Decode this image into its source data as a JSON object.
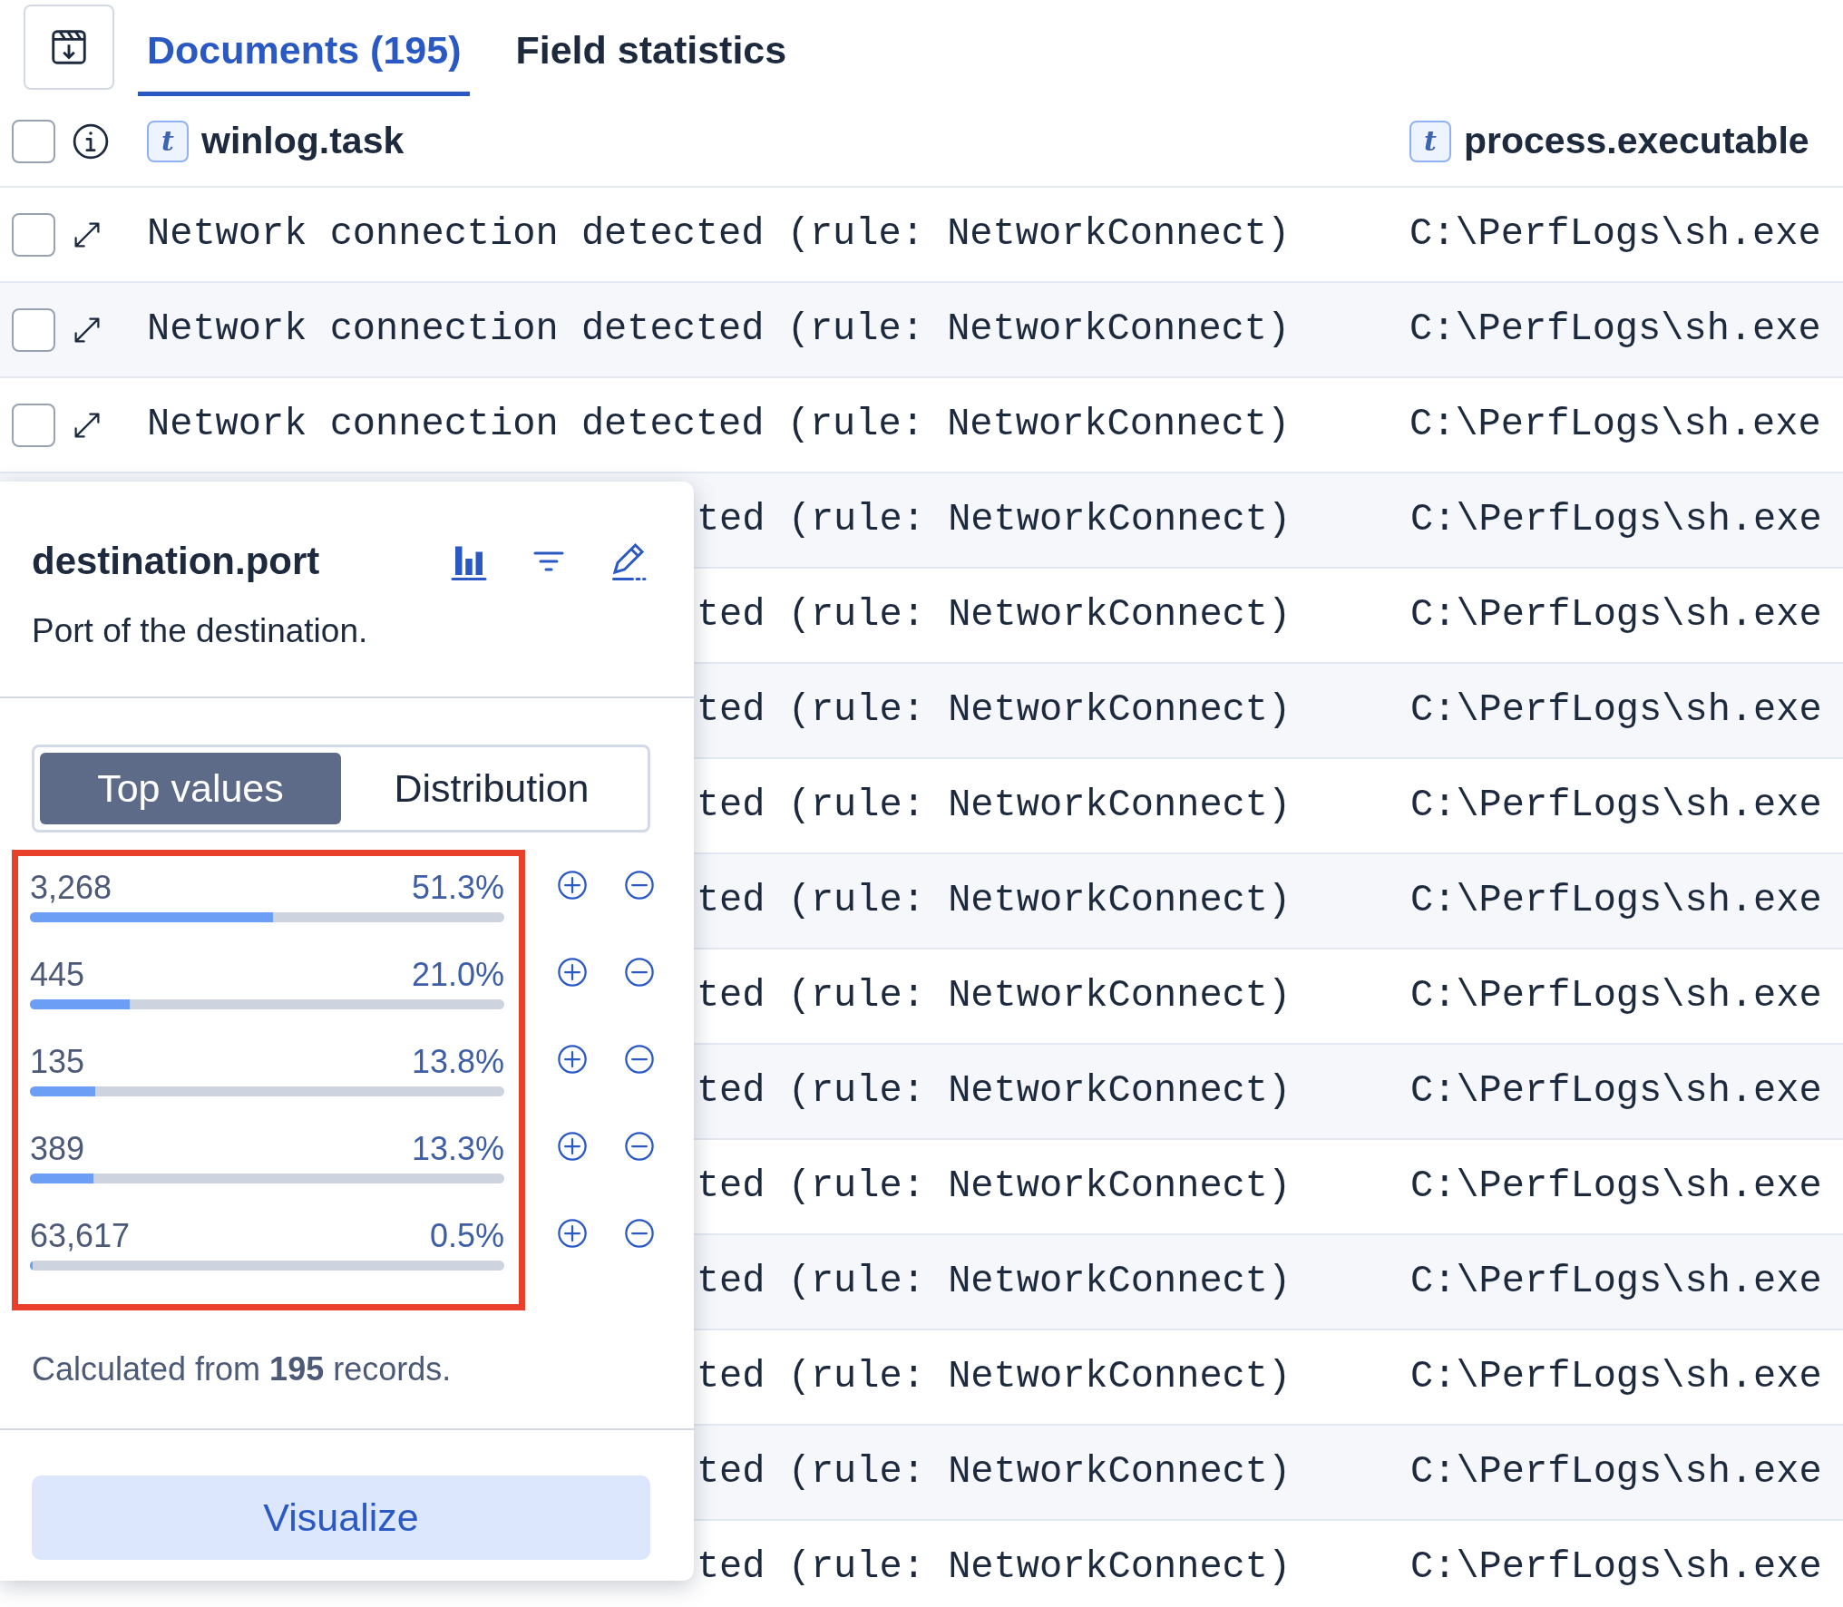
{
  "toolbar": {
    "tabs": [
      {
        "label": "Documents (195)",
        "selected": true
      },
      {
        "label": "Field statistics",
        "selected": false
      }
    ]
  },
  "table": {
    "header": {
      "checked": false,
      "columns": [
        {
          "type": "t",
          "name": "winlog.task"
        },
        {
          "type": "t",
          "name": "process.executable"
        }
      ]
    },
    "rows": [
      {
        "kind": "full",
        "checked": false,
        "task": "Network connection detected (rule: NetworkConnect)",
        "executable": "C:\\PerfLogs\\sh.exe"
      },
      {
        "kind": "full",
        "checked": false,
        "task": "Network connection detected (rule: NetworkConnect)",
        "executable": "C:\\PerfLogs\\sh.exe"
      },
      {
        "kind": "full",
        "checked": false,
        "task": "Network connection detected (rule: NetworkConnect)",
        "executable": "C:\\PerfLogs\\sh.exe"
      },
      {
        "kind": "partial",
        "task": "ted (rule: NetworkConnect)",
        "executable": "C:\\PerfLogs\\sh.exe"
      },
      {
        "kind": "partial",
        "task": "ted (rule: NetworkConnect)",
        "executable": "C:\\PerfLogs\\sh.exe"
      },
      {
        "kind": "partial",
        "task": "ted (rule: NetworkConnect)",
        "executable": "C:\\PerfLogs\\sh.exe"
      },
      {
        "kind": "partial",
        "task": "ted (rule: NetworkConnect)",
        "executable": "C:\\PerfLogs\\sh.exe"
      },
      {
        "kind": "partial",
        "task": "ted (rule: NetworkConnect)",
        "executable": "C:\\PerfLogs\\sh.exe"
      },
      {
        "kind": "partial",
        "task": "ted (rule: NetworkConnect)",
        "executable": "C:\\PerfLogs\\sh.exe"
      },
      {
        "kind": "partial",
        "task": "ted (rule: NetworkConnect)",
        "executable": "C:\\PerfLogs\\sh.exe"
      },
      {
        "kind": "partial",
        "task": "ted (rule: NetworkConnect)",
        "executable": "C:\\PerfLogs\\sh.exe"
      },
      {
        "kind": "partial",
        "task": "ted (rule: NetworkConnect)",
        "executable": "C:\\PerfLogs\\sh.exe"
      },
      {
        "kind": "partial",
        "task": "ted (rule: NetworkConnect)",
        "executable": "C:\\PerfLogs\\sh.exe"
      },
      {
        "kind": "partial",
        "task": "ted (rule: NetworkConnect)",
        "executable": "C:\\PerfLogs\\sh.exe"
      },
      {
        "kind": "partial",
        "task": "ted (rule: NetworkConnect)",
        "executable": "C:\\PerfLogs\\sh.exe"
      }
    ]
  },
  "popover": {
    "title": "destination.port",
    "description": "Port of the destination.",
    "modes": [
      {
        "label": "Top values",
        "selected": true
      },
      {
        "label": "Distribution",
        "selected": false
      }
    ],
    "top_values": {
      "highlighted": true,
      "items": [
        {
          "value": "3,268",
          "percent": "51.3%",
          "level": 0.513
        },
        {
          "value": "445",
          "percent": "21.0%",
          "level": 0.21
        },
        {
          "value": "135",
          "percent": "13.8%",
          "level": 0.138
        },
        {
          "value": "389",
          "percent": "13.3%",
          "level": 0.133
        },
        {
          "value": "63,617",
          "percent": "0.5%",
          "level": 0.005
        }
      ]
    },
    "summary": "Calculated from **195** records.",
    "button": "Visualize"
  }
}
